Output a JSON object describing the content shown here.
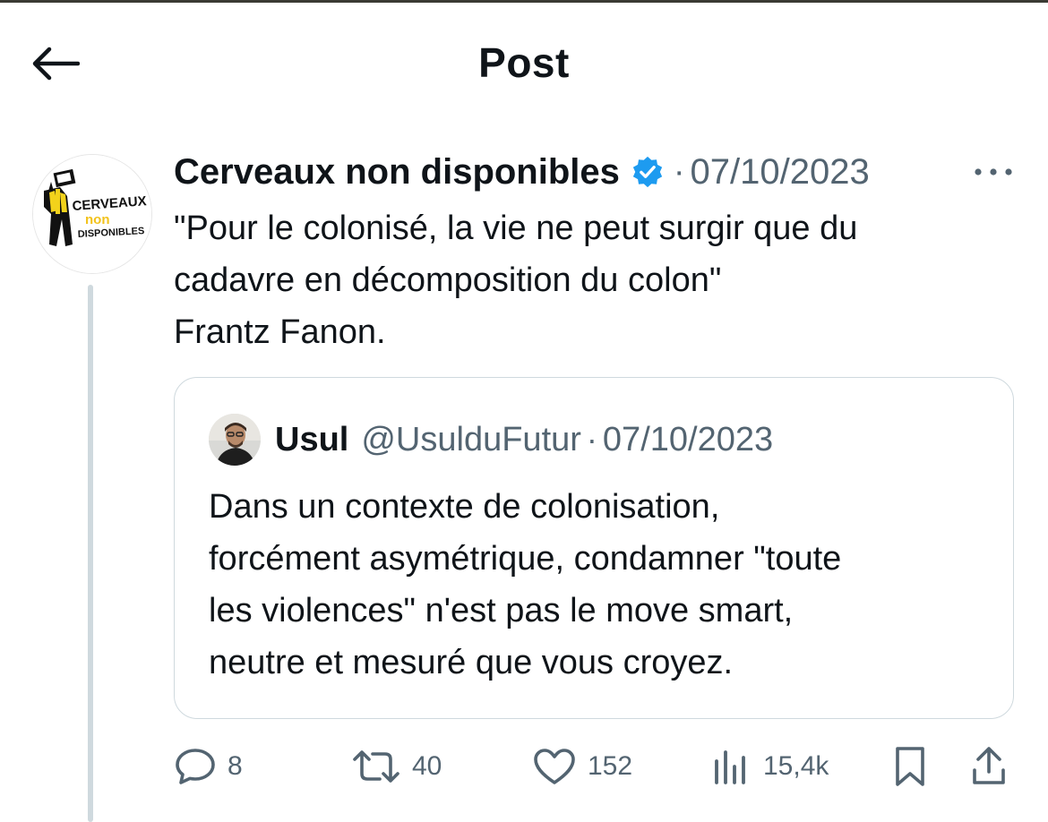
{
  "header": {
    "title": "Post"
  },
  "post": {
    "author": "Cerveaux non disponibles",
    "separator": "·",
    "date": "07/10/2023",
    "avatar_logo": {
      "line1": "CERVEAUX",
      "line2": "non",
      "line3": "DISPONIBLES"
    },
    "text_lines": [
      "\"Pour le colonisé, la vie ne peut surgir que du",
      "cadavre en décomposition du colon\"",
      "Frantz Fanon."
    ]
  },
  "quote": {
    "name": "Usul",
    "handle": "@UsulduFutur",
    "separator": "·",
    "date": "07/10/2023",
    "text_lines": [
      "Dans un contexte de colonisation,",
      "forcément asymétrique, condamner \"toute",
      "les violences\" n'est pas le move smart,",
      "neutre et mesuré que vous croyez."
    ]
  },
  "actions": {
    "replies": "8",
    "reposts": "40",
    "likes": "152",
    "views": "15,4k"
  },
  "colors": {
    "text": "#0f1419",
    "secondary": "#536471",
    "verified": "#1d9bf0",
    "border": "#cfd9de"
  }
}
